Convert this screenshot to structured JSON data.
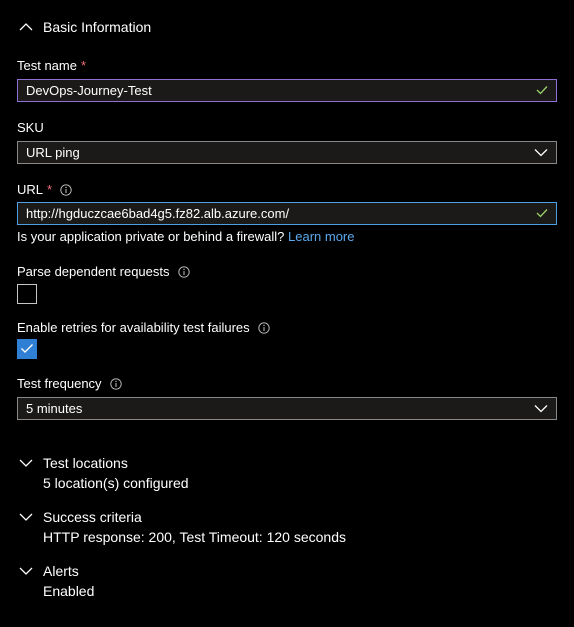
{
  "basic": {
    "title": "Basic Information",
    "test_name_label": "Test name",
    "required_mark": "*",
    "test_name_value": "DevOps-Journey-Test",
    "sku_label": "SKU",
    "sku_value": "URL ping",
    "url_label": "URL",
    "url_value": "http://hgduczcae6bad4g5.fz82.alb.azure.com/",
    "firewall_text": "Is your application private or behind a firewall?",
    "learn_more": "Learn more",
    "parse_label": "Parse dependent requests",
    "parse_checked": false,
    "retries_label": "Enable retries for availability test failures",
    "retries_checked": true,
    "frequency_label": "Test frequency",
    "frequency_value": "5 minutes"
  },
  "sections": {
    "locations": {
      "title": "Test locations",
      "summary": "5 location(s) configured"
    },
    "success": {
      "title": "Success criteria",
      "summary": "HTTP response: 200, Test Timeout: 120 seconds"
    },
    "alerts": {
      "title": "Alerts",
      "summary": "Enabled"
    }
  },
  "colors": {
    "background": "#000000",
    "required": "#f1707b",
    "link": "#5ca8ee",
    "checkbox_checked": "#2f7fd4",
    "valid_check": "#9bd26a",
    "focus_border": "#4f9fe5",
    "name_border": "#8f6fd1"
  }
}
